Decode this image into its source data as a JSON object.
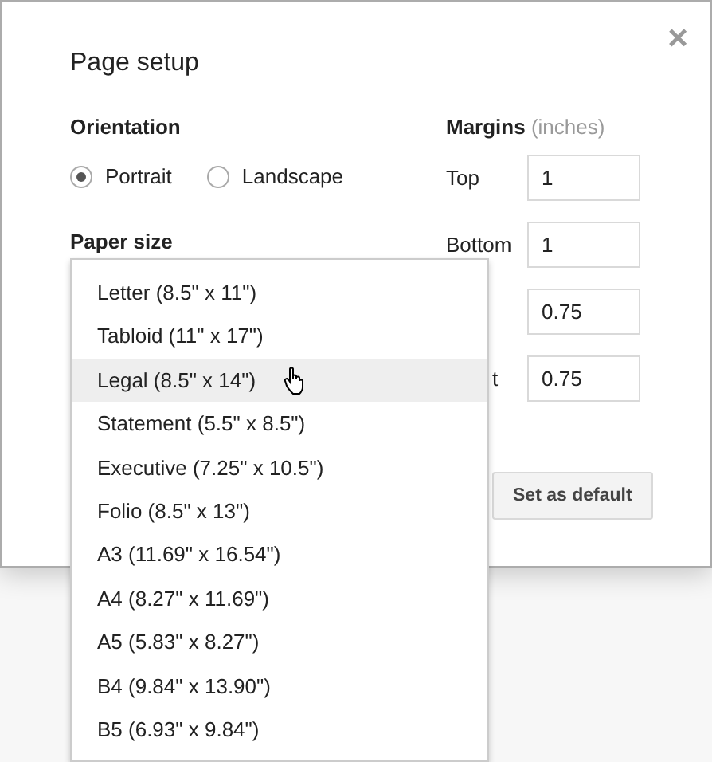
{
  "dialog": {
    "title": "Page setup",
    "close": "×"
  },
  "orientation": {
    "heading": "Orientation",
    "options": [
      {
        "label": "Portrait",
        "selected": true
      },
      {
        "label": "Landscape",
        "selected": false
      }
    ]
  },
  "paper_size": {
    "heading": "Paper size",
    "options": [
      {
        "label": "Letter (8.5\" x 11\")",
        "highlighted": false
      },
      {
        "label": "Tabloid (11\" x 17\")",
        "highlighted": false
      },
      {
        "label": "Legal (8.5\" x 14\")",
        "highlighted": true
      },
      {
        "label": "Statement (5.5\" x 8.5\")",
        "highlighted": false
      },
      {
        "label": "Executive (7.25\" x 10.5\")",
        "highlighted": false
      },
      {
        "label": "Folio (8.5\" x 13\")",
        "highlighted": false
      },
      {
        "label": "A3 (11.69\" x 16.54\")",
        "highlighted": false
      },
      {
        "label": "A4 (8.27\" x 11.69\")",
        "highlighted": false
      },
      {
        "label": "A5 (5.83\" x 8.27\")",
        "highlighted": false
      },
      {
        "label": "B4 (9.84\" x 13.90\")",
        "highlighted": false
      },
      {
        "label": "B5 (6.93\" x 9.84\")",
        "highlighted": false
      }
    ]
  },
  "margins": {
    "heading": "Margins",
    "unit": "(inches)",
    "fields": [
      {
        "label": "Top",
        "value": "1"
      },
      {
        "label": "Bottom",
        "value": "1"
      },
      {
        "value": "0.75"
      },
      {
        "label": "t",
        "value": "0.75"
      }
    ]
  },
  "buttons": [
    "Set as default"
  ]
}
